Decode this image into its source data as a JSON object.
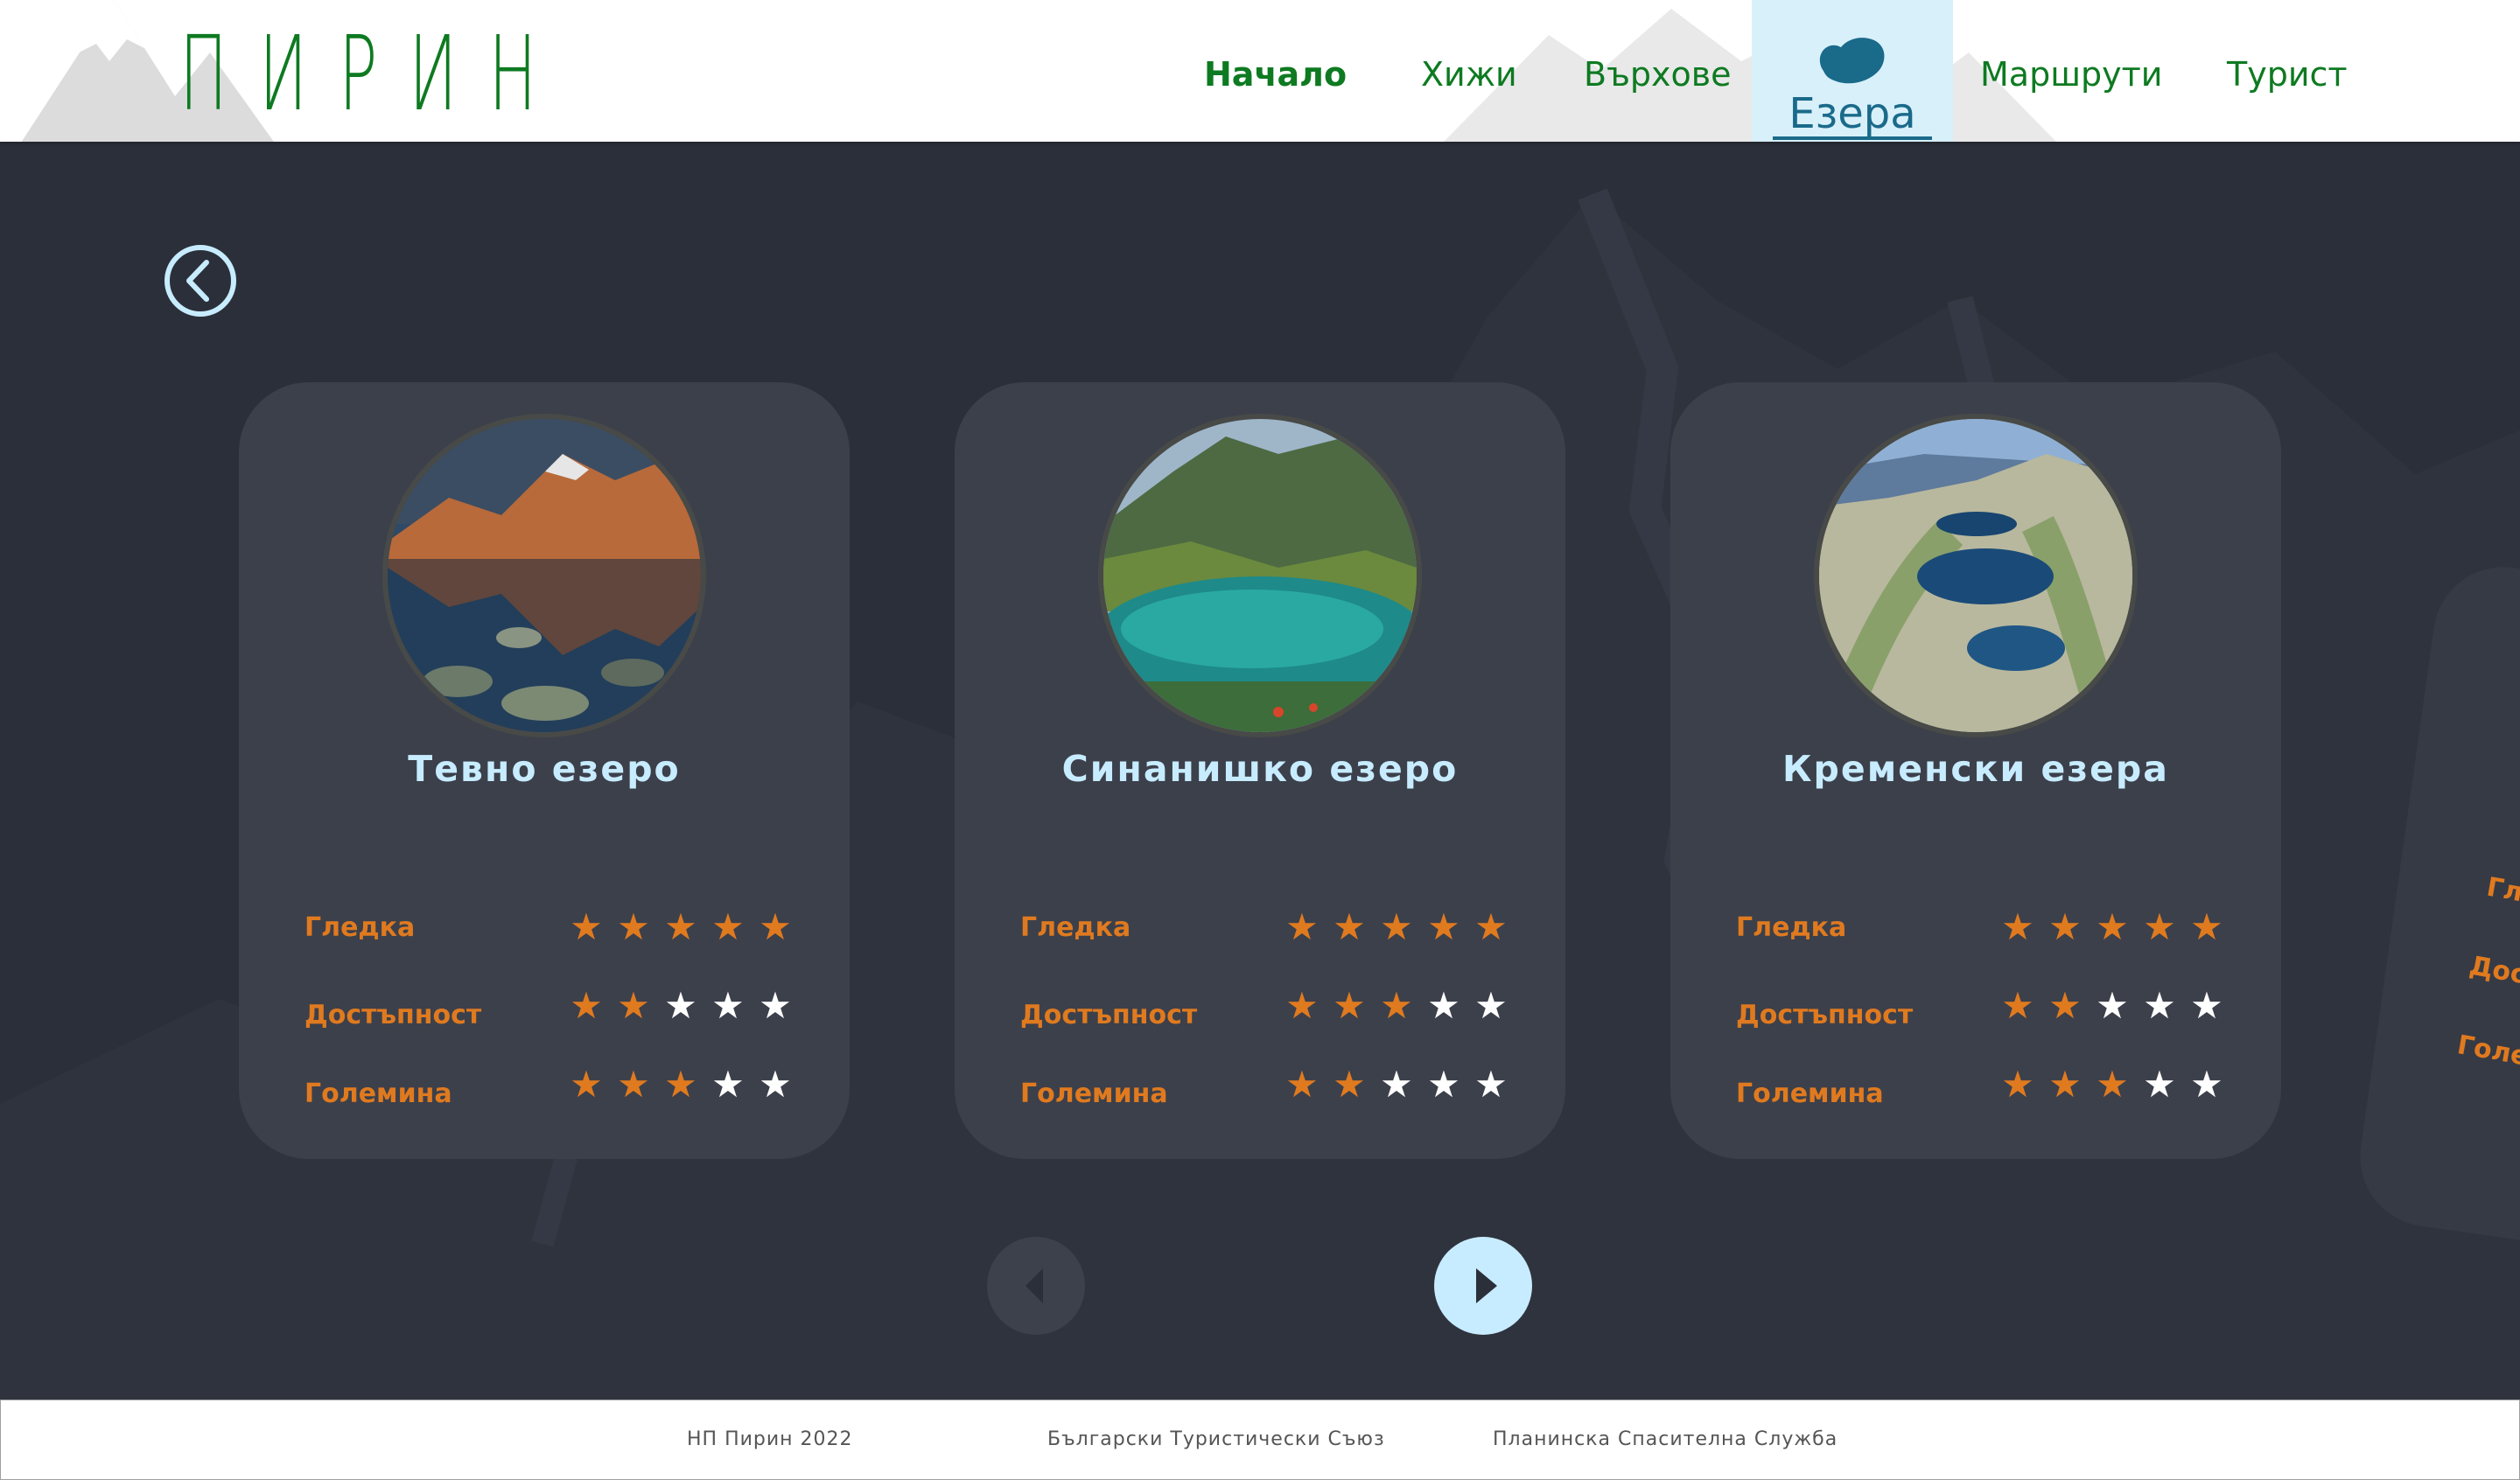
{
  "header": {
    "logo": "ПИРИН",
    "nav": [
      {
        "label": "Начало",
        "bold": true
      },
      {
        "label": "Хижи"
      },
      {
        "label": "Върхове"
      },
      {
        "label": "Езера",
        "active": true
      },
      {
        "label": "Маршрути"
      },
      {
        "label": "Турист"
      }
    ]
  },
  "colors": {
    "brand_green": "#0e7a21",
    "active_blue": "#1a6a8a",
    "active_bg": "#d8f0fa",
    "accent_orange": "#e07a1f",
    "title_blue": "#c7ecff",
    "page_bg": "#2b2f39",
    "card_bg": "#3c404b"
  },
  "cards": [
    {
      "title": "Тевно езеро",
      "ratings": [
        {
          "label": "Гледка",
          "value": 5,
          "max": 5
        },
        {
          "label": "Достъпност",
          "value": 2,
          "max": 5
        },
        {
          "label": "Големина",
          "value": 3,
          "max": 5
        }
      ]
    },
    {
      "title": "Синанишко езеро",
      "ratings": [
        {
          "label": "Гледка",
          "value": 5,
          "max": 5
        },
        {
          "label": "Достъпност",
          "value": 3,
          "max": 5
        },
        {
          "label": "Големина",
          "value": 2,
          "max": 5
        }
      ]
    },
    {
      "title": "Кременски езера",
      "ratings": [
        {
          "label": "Гледка",
          "value": 5,
          "max": 5
        },
        {
          "label": "Достъпност",
          "value": 2,
          "max": 5
        },
        {
          "label": "Големина",
          "value": 3,
          "max": 5
        }
      ]
    }
  ],
  "partial_card": {
    "labels": [
      "Гл",
      "Дос",
      "Голе"
    ]
  },
  "icons": {
    "back": "chevron-left-circle-icon",
    "prev": "triangle-left-icon",
    "next": "triangle-right-icon",
    "nav_active": "lake-icon"
  },
  "footer": {
    "items": [
      "НП Пирин 2022",
      "Български Туристически Съюз",
      "Планинска Спасителна Служба"
    ]
  }
}
